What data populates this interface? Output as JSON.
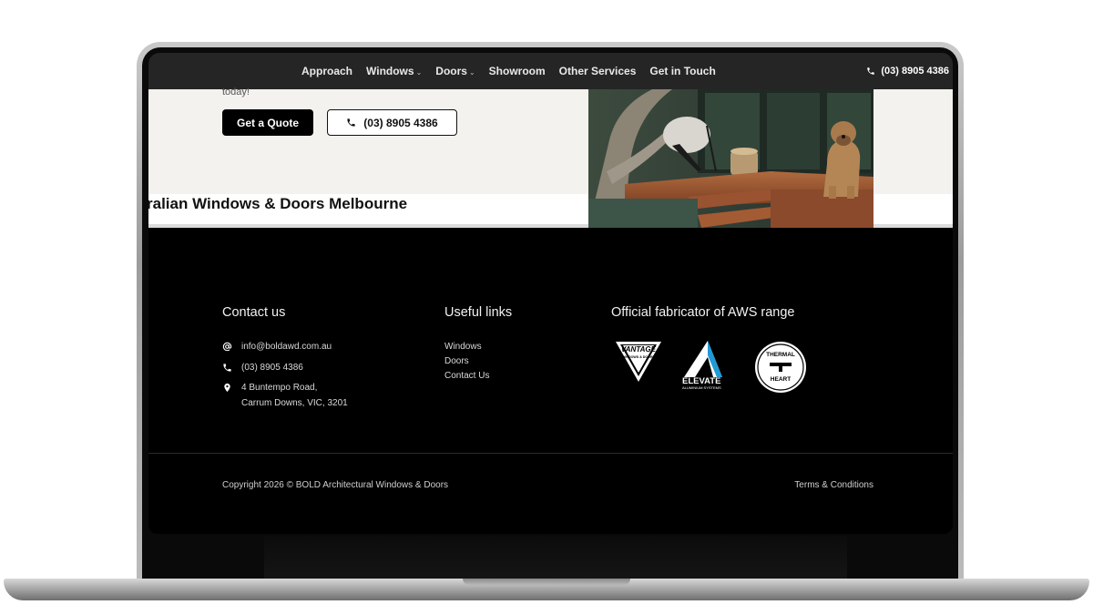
{
  "nav": {
    "links": [
      {
        "label": "Approach"
      },
      {
        "label": "Windows",
        "dropdown": true
      },
      {
        "label": "Doors",
        "dropdown": true
      },
      {
        "label": "Showroom"
      },
      {
        "label": "Other Services"
      },
      {
        "label": "Get in Touch"
      }
    ],
    "phone": "(03) 8905 4386",
    "phone_icon": "phone-icon",
    "caret_glyph": "⌄"
  },
  "hero": {
    "cut_text": "today!",
    "quote_button": "Get a Quote",
    "phone_button": "(03) 8905 4386",
    "heading": "ralian Windows & Doors Melbourne"
  },
  "footer": {
    "contact": {
      "heading": "Contact us",
      "email": "info@boldawd.com.au",
      "phone": "(03) 8905 4386",
      "address_line1": "4 Buntempo Road,",
      "address_line2": "Carrum Downs, VIC, 3201"
    },
    "links": {
      "heading": "Useful links",
      "items": [
        "Windows",
        "Doors",
        "Contact Us"
      ]
    },
    "fabricator": {
      "heading": "Official fabricator of AWS range",
      "logos": [
        {
          "name": "vantage-logo",
          "text": "VANTAGE",
          "sub": "WINDOWS & DOORS"
        },
        {
          "name": "elevate-logo",
          "text": "ELEVATE",
          "sub": "ALUMINIUM SYSTEMS"
        },
        {
          "name": "thermalheart-logo",
          "text": "THERMAL",
          "sub": "HEART"
        }
      ]
    },
    "copyright": "Copyright 2026 © BOLD Architectural Windows & Doors",
    "terms": "Terms & Conditions"
  },
  "colors": {
    "nav_bg": "#252525",
    "hero_bg": "#f4f2ee",
    "footer_bg": "#000000",
    "accent_blue": "#1f9ad6"
  }
}
